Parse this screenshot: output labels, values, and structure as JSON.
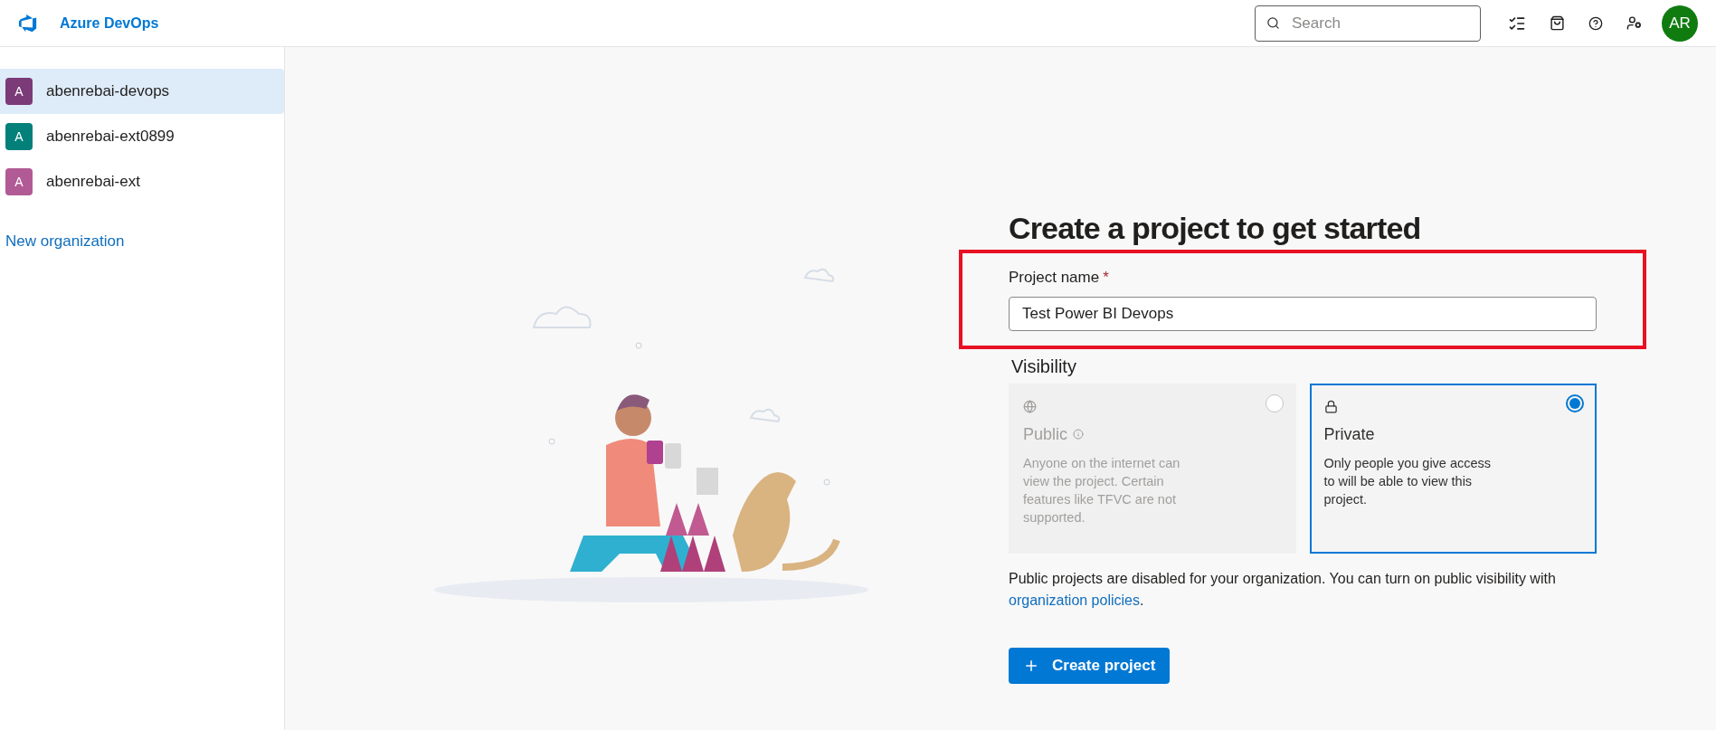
{
  "header": {
    "product": "Azure DevOps",
    "search": {
      "placeholder": "Search"
    },
    "avatar": "AR"
  },
  "sidebar": {
    "organizations": [
      {
        "initial": "A",
        "name": "abenrebai-devops",
        "color": "#7b3a78",
        "selected": true
      },
      {
        "initial": "A",
        "name": "abenrebai-ext0899",
        "color": "#03807a",
        "selected": false
      },
      {
        "initial": "A",
        "name": "abenrebai-ext",
        "color": "#b15a95",
        "selected": false
      }
    ],
    "new_link": "New organization"
  },
  "form": {
    "heading": "Create a project to get started",
    "field_label": "Project name",
    "required_mark": "*",
    "project_name": "Test Power BI Devops",
    "visibility_label": "Visibility",
    "options": [
      {
        "kind": "public",
        "title": "Public",
        "description": "Anyone on the internet can view the project. Certain features like TFVC are not supported.",
        "selected": false,
        "disabled": true
      },
      {
        "kind": "private",
        "title": "Private",
        "description": "Only people you give access to will be able to view this project.",
        "selected": true,
        "disabled": false
      }
    ],
    "notice": "Public projects are disabled for your organization. You can turn on public visibility with",
    "notice_link": "organization policies",
    "notice_end": ".",
    "create_button": "Create project"
  }
}
